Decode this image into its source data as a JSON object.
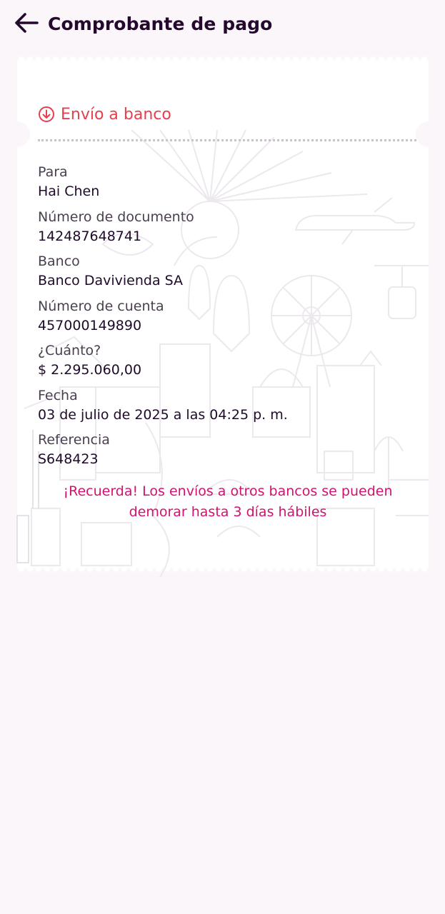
{
  "header": {
    "title": "Comprobante de pago"
  },
  "receipt": {
    "transfer_type": "Envío a banco",
    "fields": [
      {
        "label": "Para",
        "value": "Hai Chen"
      },
      {
        "label": "Número de documento",
        "value": "142487648741"
      },
      {
        "label": "Banco",
        "value": "Banco Davivienda SA"
      },
      {
        "label": "Número de cuenta",
        "value": "457000149890"
      },
      {
        "label": "¿Cuánto?",
        "value": "$ 2.295.060,00"
      },
      {
        "label": "Fecha",
        "value": "03 de julio de 2025 a las 04:25 p. m."
      },
      {
        "label": "Referencia",
        "value": "S648423"
      }
    ],
    "notice_line1": "¡Recuerda! Los envíos a otros bancos se pueden",
    "notice_line2": "demorar hasta 3 días hábiles"
  },
  "colors": {
    "background": "#fbf6fa",
    "accent_red": "#e5404e",
    "notice_magenta": "#d1136f",
    "text_dark": "#1f0a2a"
  },
  "icons": {
    "back": "arrow-left-icon",
    "transfer": "arrow-down-circle-icon"
  }
}
